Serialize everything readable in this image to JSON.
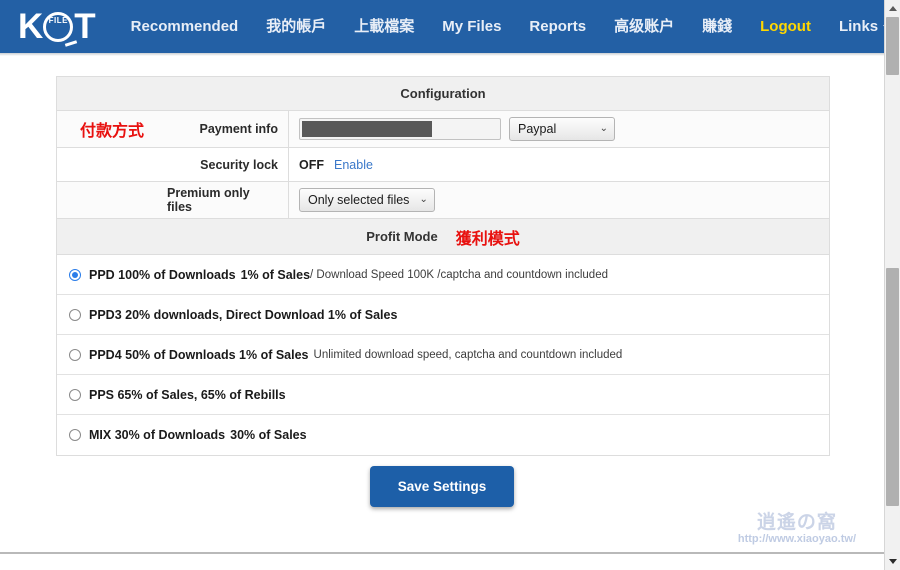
{
  "navbar": {
    "brand": {
      "left": "K",
      "emblem": "FILE",
      "right": "T"
    },
    "items": [
      {
        "label": "Recommended",
        "highlight": false,
        "caret": false
      },
      {
        "label": "我的帳戶",
        "highlight": false,
        "caret": false
      },
      {
        "label": "上載檔案",
        "highlight": false,
        "caret": false
      },
      {
        "label": "My Files",
        "highlight": false,
        "caret": false
      },
      {
        "label": "Reports",
        "highlight": false,
        "caret": false
      },
      {
        "label": "高级账户",
        "highlight": false,
        "caret": false
      },
      {
        "label": "賺錢",
        "highlight": false,
        "caret": false
      },
      {
        "label": "Logout",
        "highlight": true,
        "caret": false
      },
      {
        "label": "Links",
        "highlight": false,
        "caret": true
      }
    ],
    "language_flag": "china-flag-icon",
    "accent_color": "#2360a5",
    "highlight_color": "#ffd700"
  },
  "panel": {
    "title": "Configuration",
    "rows": [
      {
        "annotation": "付款方式",
        "label": "Payment info",
        "input_value": "",
        "input_redacted": true,
        "select_value": "Paypal"
      },
      {
        "annotation": "",
        "label": "Security lock",
        "status": "OFF",
        "action_link": "Enable"
      },
      {
        "annotation": "",
        "label": "Premium only files",
        "select_value": "Only selected files"
      }
    ]
  },
  "profit_mode": {
    "label": "Profit Mode",
    "annotation": "獲利模式",
    "annotation_color": "#e8110f",
    "options": [
      {
        "selected": true,
        "strong": "PPD 100% of Downloads",
        "strong2": "1% of Sales",
        "sub": "/ Download Speed 100K /captcha and countdown included"
      },
      {
        "selected": false,
        "strong": "PPD3 20% downloads, Direct Download 1% of Sales",
        "strong2": "",
        "sub": ""
      },
      {
        "selected": false,
        "strong": "PPD4 50% of Downloads 1% of Sales",
        "strong2": "",
        "sub": "Unlimited download speed, captcha and countdown included"
      },
      {
        "selected": false,
        "strong": "PPS 65% of Sales, 65% of Rebills",
        "strong2": "",
        "sub": ""
      },
      {
        "selected": false,
        "strong": "MIX 30% of Downloads",
        "strong2": "30% of Sales",
        "sub": ""
      }
    ]
  },
  "actions": {
    "save_label": "Save Settings",
    "save_color": "#1d5fa8"
  },
  "watermark": {
    "cjk": "逍遙の窩",
    "url": "http://www.xiaoyao.tw/"
  }
}
